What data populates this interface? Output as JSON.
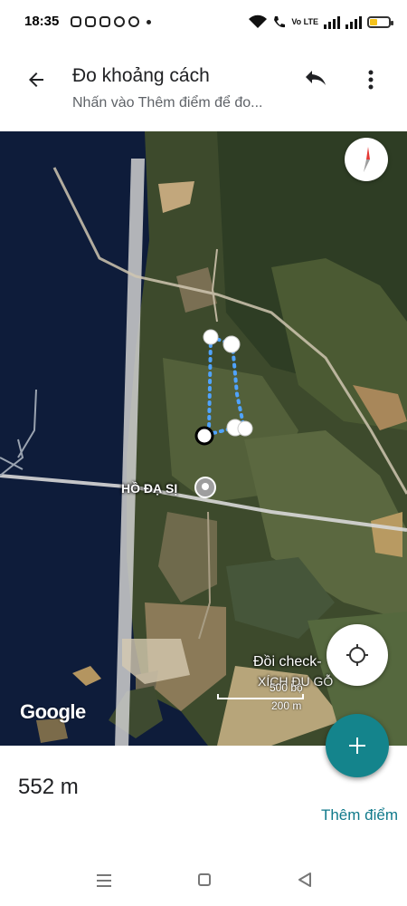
{
  "status": {
    "time": "18:35",
    "network": "Vo LTE",
    "battery_level": 0.4
  },
  "header": {
    "title": "Đo khoảng cách",
    "subtitle": "Nhấn vào Thêm điểm để đo...",
    "back_icon": "arrow-back-icon",
    "undo_icon": "undo-icon",
    "more_icon": "more-vert-icon"
  },
  "map": {
    "place_label": "HỒ ĐẠ SỊ",
    "poi_label": "Đồi check-",
    "poi_label2": "XÍCH ĐU GỖ",
    "scale_top": "500 bộ",
    "scale_bottom": "200 m",
    "logo": "Google",
    "accent": "#1a73e8",
    "water": "#0e1c3a"
  },
  "measurement": {
    "distance": "552 m",
    "add_point_label": "Thêm điểm"
  },
  "colors": {
    "fab": "#14848c",
    "accent_text": "#117a8b"
  }
}
